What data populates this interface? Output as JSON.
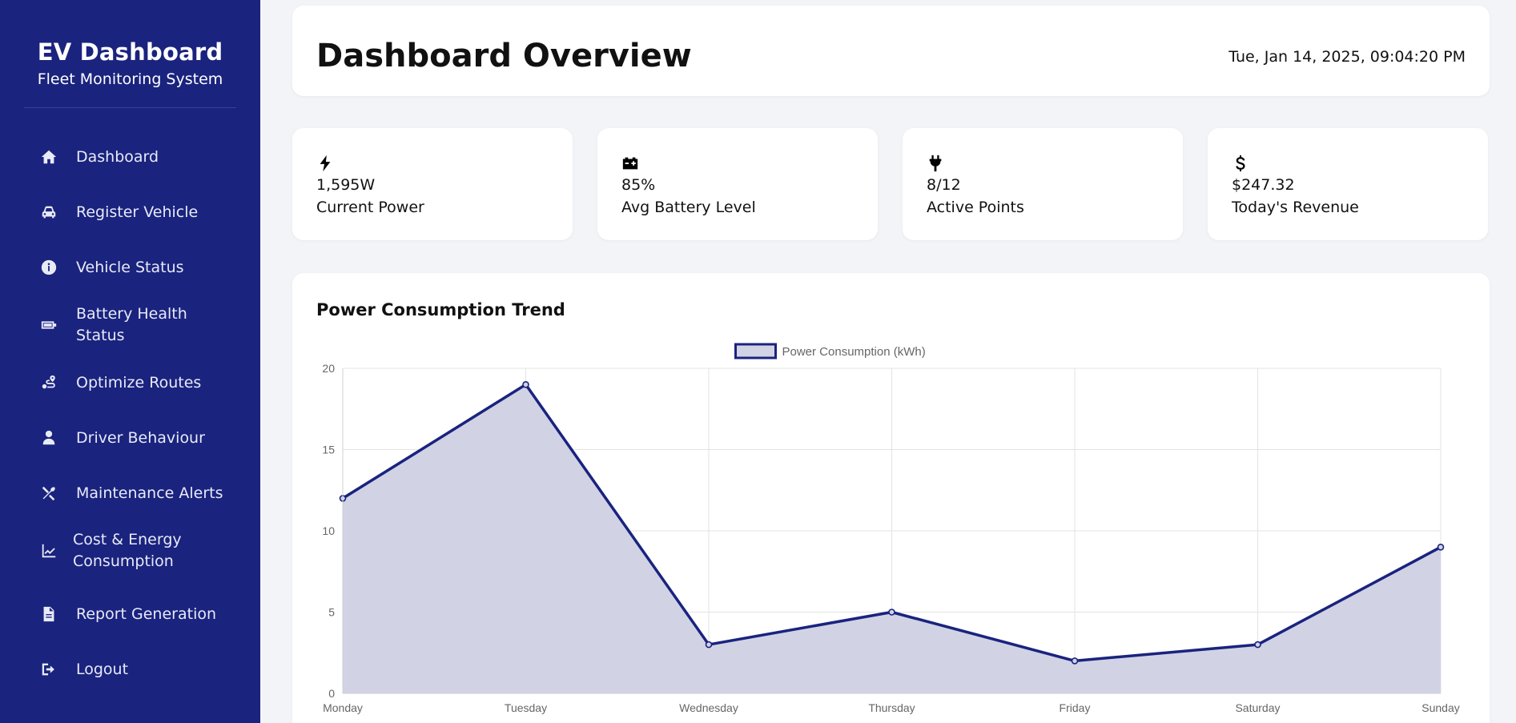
{
  "brand": {
    "title": "EV Dashboard",
    "subtitle": "Fleet Monitoring System"
  },
  "nav": [
    {
      "label": "Dashboard",
      "icon": "home-icon"
    },
    {
      "label": "Register Vehicle",
      "icon": "car-icon"
    },
    {
      "label": "Vehicle Status",
      "icon": "info-icon"
    },
    {
      "label": "Battery Health Status",
      "icon": "battery-icon"
    },
    {
      "label": "Optimize Routes",
      "icon": "route-icon"
    },
    {
      "label": "Driver Behaviour",
      "icon": "driver-icon"
    },
    {
      "label": "Maintenance Alerts",
      "icon": "tools-icon"
    },
    {
      "label": "Cost & Energy Consumption",
      "icon": "chart-line-icon"
    },
    {
      "label": "Report Generation",
      "icon": "document-icon"
    },
    {
      "label": "Logout",
      "icon": "logout-icon"
    }
  ],
  "header": {
    "title": "Dashboard Overview",
    "datetime": "Tue, Jan 14, 2025, 09:04:20 PM"
  },
  "stats": [
    {
      "value": "1,595W",
      "label": "Current Power",
      "icon": "bolt-icon"
    },
    {
      "value": "85%",
      "label": "Avg Battery Level",
      "icon": "car-battery-icon"
    },
    {
      "value": "8/12",
      "label": "Active Points",
      "icon": "plug-icon"
    },
    {
      "value": "$247.32",
      "label": "Today's Revenue",
      "icon": "dollar-icon"
    }
  ],
  "chart_card": {
    "title": "Power Consumption Trend"
  },
  "colors": {
    "sidebar": "#1a237e",
    "series_line": "#1a237e",
    "series_fill": "#d1d3e5"
  },
  "chart_data": {
    "type": "area",
    "categories": [
      "Monday",
      "Tuesday",
      "Wednesday",
      "Thursday",
      "Friday",
      "Saturday",
      "Sunday"
    ],
    "series": [
      {
        "name": "Power Consumption (kWh)",
        "values": [
          12,
          19,
          3,
          5,
          2,
          3,
          9
        ]
      }
    ],
    "ylim": [
      0,
      20
    ],
    "yticks": [
      0,
      5,
      10,
      15,
      20
    ],
    "legend": "top-center",
    "grid": true
  }
}
